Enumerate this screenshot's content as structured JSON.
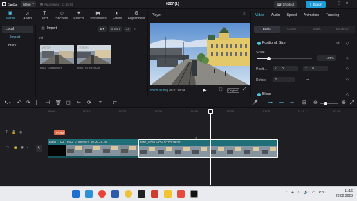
{
  "titlebar": {
    "app_name": "CapCut",
    "menu_label": "Menu",
    "autosave": "Auto saved: 11:16:02",
    "project_title": "0227 (1)",
    "shortcut_label": "Shortcut",
    "export_label": "Export",
    "window_controls": [
      "–",
      "▢",
      "✕"
    ]
  },
  "toolbar": {
    "items": [
      {
        "label": "Media",
        "icon": "media-icon"
      },
      {
        "label": "Audio",
        "icon": "audio-icon"
      },
      {
        "label": "Text",
        "icon": "text-icon"
      },
      {
        "label": "Stickers",
        "icon": "stickers-icon"
      },
      {
        "label": "Effects",
        "icon": "effects-icon"
      },
      {
        "label": "Transitions",
        "icon": "transitions-icon"
      },
      {
        "label": "Filters",
        "icon": "filters-icon"
      },
      {
        "label": "Adjustment",
        "icon": "adjustment-icon"
      }
    ]
  },
  "leftnav": {
    "items": [
      "Local",
      "Import",
      "Library"
    ]
  },
  "media": {
    "import_label": "Import",
    "sort_label": "Sort",
    "all_btn": "All",
    "all_label": "All",
    "clips": [
      {
        "badge": "Added",
        "name": "IMG_0788.MOV"
      },
      {
        "badge": "Added",
        "name": "IMG_0789.MOV"
      }
    ]
  },
  "player": {
    "title": "Player",
    "current_time": "00:00:46:08",
    "total_time": "00:01:05:06",
    "original_label": "Original"
  },
  "inspector": {
    "tabs": [
      "Video",
      "Audio",
      "Speed",
      "Animation",
      "Tracking"
    ],
    "subtabs": [
      "Basic",
      "Cutout",
      "Mask",
      "Enhance"
    ],
    "position_size_label": "Position & Size",
    "scale_label": "Scale",
    "scale_value": "100%",
    "position_label": "Positi...",
    "pos_x_label": "X",
    "pos_x": "0",
    "pos_y_label": "Y",
    "pos_y": "0",
    "rotate_label": "Rotate",
    "rotate_value": "0°",
    "blend_label": "Blend",
    "scale_fraction": 0.22
  },
  "timeline": {
    "ruler_ticks": [
      "00:00",
      "00:10",
      "00:20",
      "00:30",
      "00:40",
      "00:50",
      "01:00",
      "01:10",
      "01:20"
    ],
    "text_clip": "ПРОБА",
    "clip1_label": "IMG_0788.MOV  00:00:20:28",
    "clip_bw_label": "B&W",
    "clip_bw_time": "00",
    "clip2_label": "IMG_0789.MOV  00:00:39:08"
  },
  "taskbar": {
    "lang": "РУС",
    "time": "11:16",
    "date": "28.02.2023"
  },
  "colors": {
    "accent": "#4fc3e8",
    "export": "#1d9bd6",
    "clip_teal": "#1f6f78",
    "text_clip": "#e06b4a"
  }
}
